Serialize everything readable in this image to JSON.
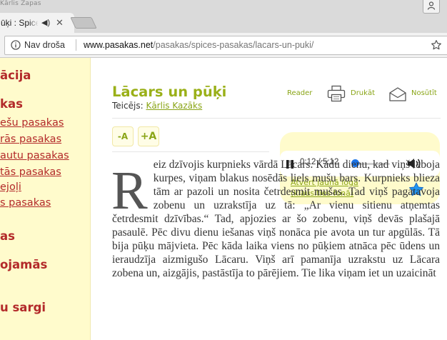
{
  "browser": {
    "window_title": "Kārlis Zapas",
    "tab": {
      "title": "ūķi : Spices"
    },
    "omnibox": {
      "security_label": "Nav droša",
      "url_host": "www.pasakas.net",
      "url_path": "/pasakas/spices-pasakas/lacars-un-puki/"
    }
  },
  "sidebar": {
    "items": [
      {
        "label": "ācija"
      },
      {
        "label": "kas"
      },
      {
        "label": "ešu pasakas"
      },
      {
        "label": "rās pasakas"
      },
      {
        "label": "autu pasakas"
      },
      {
        "label": "tās pasakas"
      },
      {
        "label": "ejoļi"
      },
      {
        "label": "s pasakas"
      },
      {
        "label": "as"
      },
      {
        "label": "ojamās"
      },
      {
        "label": "u sargi"
      }
    ]
  },
  "article": {
    "title": "Lācars un pūķi",
    "narrator_label": "Teicējs:",
    "narrator_name": "Kārlis Kazāks",
    "actions": {
      "reader": "Reader",
      "print": "Drukāt",
      "send": "Nosūtīt"
    },
    "font_controls": {
      "decrease": "-A",
      "increase": "+A"
    }
  },
  "player": {
    "time": "0:12 / 5:12",
    "progress": 0.038,
    "open_link_line1": "Atvērt jaunā logā",
    "open_link_line2": "(klausīties fonā)"
  },
  "story": {
    "drop_cap": "R",
    "text": "eiz dzīvojis kurpnieks vārdā Lācars. Kādu dienu, kad viņš laboja kurpes, viņam blakus nosēdās liels mušu bars. Kurpnieks blieza tām ar pazoli un nosita četrdesmit mušas. Tad viņš pagatavoja zobenu un uzrakstīja uz tā: „Ar vienu sitienu atņemtas četrdesmit dzīvības.“ Tad, apjozies ar šo zobenu, viņš devās plašajā pasaulē. Pēc divu dienu iešanas viņš nonāca pie avota un tur apgūlās. Tā bija pūķu mājvieta. Pēc kāda laika viens no pūķiem atnāca pēc ūdens un ieraudzīja aizmigušo Lācaru. Viņš arī pamanīja uzrakstu uz Lācara zobena un, aizgājis, pastāstīja to pārējiem. Tie lika viņam iet un uzaicināt"
  },
  "colors": {
    "sidebar_bg": "#fffbcc",
    "sidebar_text": "#b32a2a",
    "accent_green": "#8aa517",
    "title_green": "#9ab018",
    "player_blue": "#1a73e8",
    "favorite_star": "#2196f3"
  },
  "icons": [
    "info-icon",
    "bookmark-star-icon",
    "user-icon",
    "audio-icon",
    "close-icon",
    "printer-icon",
    "envelope-icon",
    "pause-icon",
    "volume-icon",
    "favorite-star-icon"
  ]
}
